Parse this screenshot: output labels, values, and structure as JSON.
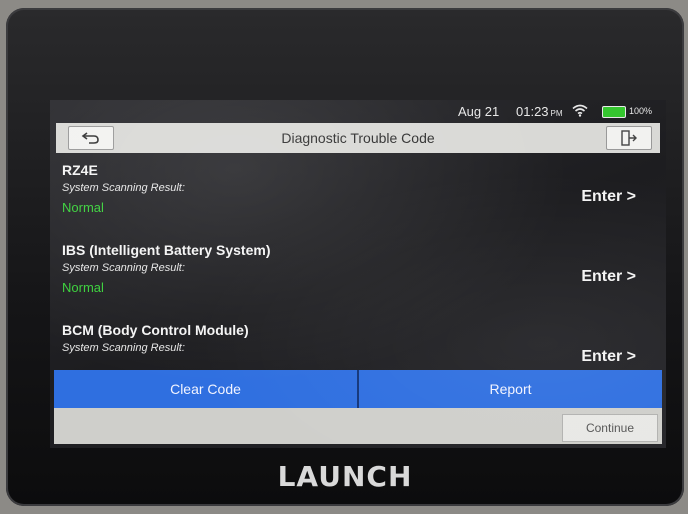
{
  "status": {
    "date": "Aug 21",
    "time": "01:23",
    "ampm": "PM",
    "battery": "100%",
    "battery_color": "#35c62f"
  },
  "title": "Diagnostic Trouble Code",
  "icons": {
    "back": "back-arrow-icon",
    "exit": "exit-door-icon",
    "wifi": "wifi-icon"
  },
  "modules": [
    {
      "name": "RZ4E",
      "sub": "System Scanning Result:",
      "status": "Normal",
      "enter": "Enter >"
    },
    {
      "name": "IBS (Intelligent Battery System)",
      "sub": "System Scanning Result:",
      "status": "Normal",
      "enter": "Enter >"
    },
    {
      "name": "BCM (Body Control Module)",
      "sub": "System Scanning Result:",
      "status": "",
      "enter": "Enter >"
    }
  ],
  "actions": {
    "clear": "Clear Code",
    "report": "Report",
    "continue": "Continue"
  },
  "brand": "LAUNCH",
  "colors": {
    "accent_blue": "#2f6fe0",
    "status_green": "#39d13a"
  }
}
